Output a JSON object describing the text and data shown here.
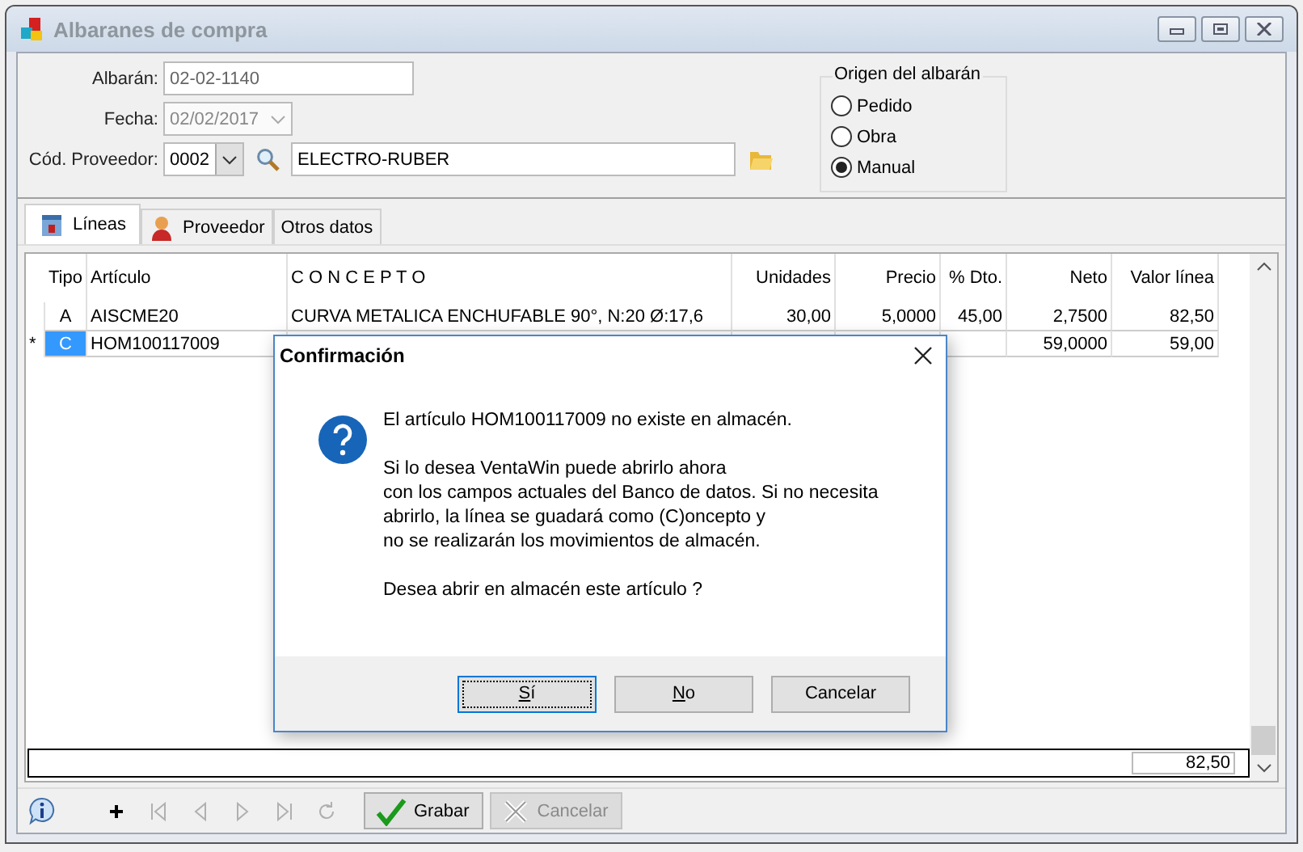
{
  "window": {
    "title": "Albaranes de compra"
  },
  "form": {
    "albaran": {
      "label": "Albarán:",
      "value": "02-02-1140"
    },
    "fecha": {
      "label": "Fecha:",
      "value": "02/02/2017",
      "disabled": true
    },
    "proveedor": {
      "label": "Cód. Proveedor:",
      "code": "0002",
      "name": "ELECTRO-RUBER"
    }
  },
  "origen": {
    "title": "Origen del albarán",
    "options": [
      {
        "label": "Pedido",
        "selected": false
      },
      {
        "label": "Obra",
        "selected": false
      },
      {
        "label": "Manual",
        "selected": true
      }
    ]
  },
  "tabs": [
    {
      "label": "Líneas",
      "kind": "lines",
      "selected": true
    },
    {
      "label": "Proveedor",
      "kind": "person",
      "selected": false
    },
    {
      "label": "Otros datos",
      "kind": "none",
      "selected": false
    }
  ],
  "table": {
    "columns": [
      "Tipo",
      "Artículo",
      "C O N C E P T O",
      "Unidades",
      "Precio",
      "% Dto.",
      "Neto",
      "Valor línea"
    ],
    "rows": [
      {
        "marker": "",
        "tipo": "A",
        "articulo": "AISCME20",
        "concepto": "CURVA METALICA ENCHUFABLE 90°, N:20 Ø:17,6",
        "unidades": "30,00",
        "precio": "5,0000",
        "dto": "45,00",
        "neto": "2,7500",
        "valor": "82,50",
        "selected": false
      },
      {
        "marker": "*",
        "tipo": "C",
        "articulo": "HOM100117009",
        "neto": "59,0000",
        "valor": "59,00",
        "selected": true
      }
    ],
    "total": "82,50"
  },
  "nav": [
    {
      "kind": "add",
      "disabled": false
    },
    {
      "kind": "first",
      "disabled": true
    },
    {
      "kind": "prev",
      "disabled": true
    },
    {
      "kind": "next",
      "disabled": true
    },
    {
      "kind": "last",
      "disabled": true
    },
    {
      "kind": "refresh",
      "disabled": true
    }
  ],
  "toolbar": [
    {
      "label": "Grabar",
      "kind": "save",
      "disabled": false
    },
    {
      "label": "Cancelar",
      "kind": "cancel",
      "disabled": true
    }
  ],
  "dialog": {
    "title": "Confirmación",
    "paragraphs": [
      "El artículo HOM100117009 no existe en almacén.",
      "Si lo desea VentaWin puede abrirlo ahora\ncon los campos actuales del Banco de datos. Si no necesita\nabrirlo, la línea se guadará como (C)oncepto y\nno se realizarán los movimientos de almacén.",
      "Desea abrir en almacén este artículo ?"
    ],
    "buttons": [
      {
        "label": "Sí",
        "underline_first": true,
        "focused": true
      },
      {
        "label": "No",
        "underline_first": true,
        "focused": false
      },
      {
        "label": "Cancelar",
        "underline_first": false,
        "focused": false
      }
    ]
  }
}
